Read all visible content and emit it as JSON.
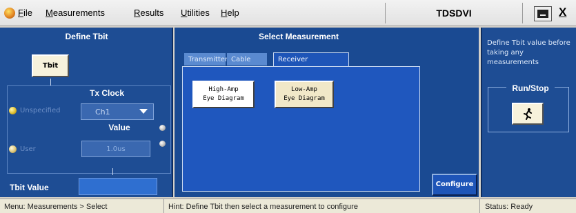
{
  "menubar": {
    "items": [
      {
        "underline": "F",
        "rest": "ile"
      },
      {
        "underline": "M",
        "rest": "easurements"
      },
      {
        "underline": "R",
        "rest": "esults"
      },
      {
        "underline": "U",
        "rest": "tilities"
      },
      {
        "underline": "H",
        "rest": "elp"
      }
    ],
    "app_title": "TDSDVI",
    "close_glyph": "X"
  },
  "define_tbit": {
    "title": "Define Tbit",
    "tbit_button": "Tbit",
    "tx_clock_label": "Tx Clock",
    "option_unspecified": "Unspecified",
    "clock_dropdown": "Ch1",
    "value_label": "Value",
    "option_user": "User",
    "value_field": "1.0us",
    "tbit_value_label": "Tbit Value",
    "tbit_value": ""
  },
  "select_measurement": {
    "title": "Select Measurement",
    "tabs": [
      "Transmitter",
      "Cable",
      "Receiver"
    ],
    "active_tab": "Receiver",
    "buttons": [
      {
        "line1": "High-Amp",
        "line2": "Eye Diagram"
      },
      {
        "line1": "Low-Amp",
        "line2": "Eye Diagram"
      }
    ]
  },
  "configure_button": "Configure",
  "right_panel": {
    "notice": "Define Tbit value before taking any measurements",
    "runstop_title": "Run/Stop",
    "runstop_icon": "running-man-icon"
  },
  "statusbar": {
    "menu_path": "Menu: Measurements > Select",
    "hint": "Hint: Define Tbit then select a measurement to configure",
    "status": "Status: Ready"
  }
}
